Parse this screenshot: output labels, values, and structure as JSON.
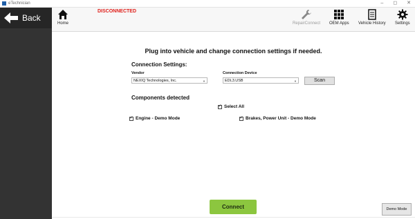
{
  "window": {
    "title": "eTechnician",
    "controls": {
      "minimize": "–",
      "maximize": "◻",
      "close": "✕"
    }
  },
  "sidebar": {
    "back_label": "Back",
    "back_icon": "arrow-left-icon"
  },
  "toolbar": {
    "status": "DISCONNECTED",
    "status_color": "#e0201b",
    "home_label": "Home",
    "repair_label": "RepairConnect",
    "oem_label": "OEM Apps",
    "history_label": "Vehicle History",
    "settings_label": "Settings"
  },
  "main": {
    "title": "Plug into vehicle and change connection settings if needed.",
    "connection_settings_heading": "Connection Settings:",
    "vendor_label": "Vendor",
    "vendor_value": "NEXIQ Technologies, Inc.",
    "device_label": "Connection Device",
    "device_value": "EDL3.USB",
    "scan_label": "Scan",
    "components_heading": "Components detected",
    "select_all_label": "Select All",
    "select_all_checked": true,
    "components": [
      {
        "label": "Engine - Demo Mode",
        "checked": true
      },
      {
        "label": "Brakes, Power Unit - Demo Mode",
        "checked": true
      }
    ],
    "connect_label": "Connect",
    "connect_color": "#8cc63f",
    "demo_mode_label": "Demo Mode"
  }
}
